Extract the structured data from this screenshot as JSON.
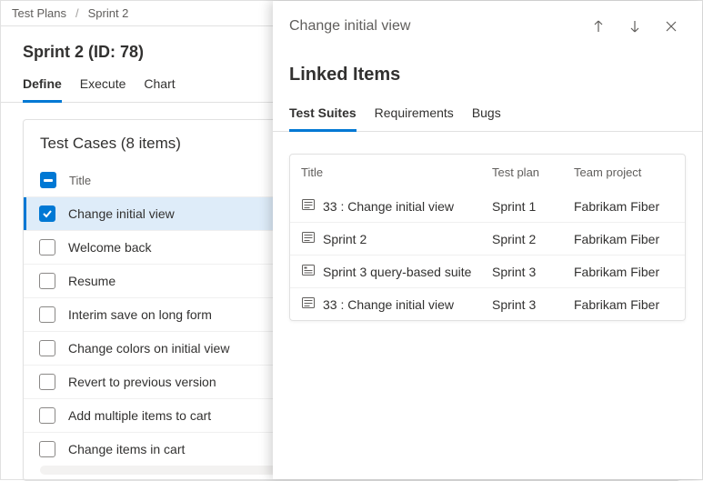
{
  "breadcrumb": {
    "root": "Test Plans",
    "current": "Sprint 2"
  },
  "page": {
    "title": "Sprint 2 (ID: 78)"
  },
  "main_tabs": [
    {
      "label": "Define",
      "active": true
    },
    {
      "label": "Execute",
      "active": false
    },
    {
      "label": "Chart",
      "active": false
    }
  ],
  "testcases": {
    "heading": "Test Cases (8 items)",
    "column_title": "Title",
    "items": [
      {
        "title": "Change initial view",
        "checked": true,
        "selected": true
      },
      {
        "title": "Welcome back",
        "checked": false
      },
      {
        "title": "Resume",
        "checked": false
      },
      {
        "title": "Interim save on long form",
        "checked": false
      },
      {
        "title": "Change colors on initial view",
        "checked": false
      },
      {
        "title": "Revert to previous version",
        "checked": false
      },
      {
        "title": "Add multiple items to cart",
        "checked": false
      },
      {
        "title": "Change items in cart",
        "checked": false
      }
    ]
  },
  "panel": {
    "title": "Change initial view",
    "section": "Linked Items",
    "tabs": [
      {
        "label": "Test Suites",
        "active": true
      },
      {
        "label": "Requirements",
        "active": false
      },
      {
        "label": "Bugs",
        "active": false
      }
    ],
    "columns": {
      "title": "Title",
      "plan": "Test plan",
      "team": "Team project"
    },
    "rows": [
      {
        "icon": "static",
        "title": "33 : Change initial view",
        "plan": "Sprint 1",
        "team": "Fabrikam Fiber"
      },
      {
        "icon": "static",
        "title": "Sprint 2",
        "plan": "Sprint 2",
        "team": "Fabrikam Fiber"
      },
      {
        "icon": "query",
        "title": "Sprint 3 query-based suite",
        "plan": "Sprint 3",
        "team": "Fabrikam Fiber"
      },
      {
        "icon": "static",
        "title": "33 : Change initial view",
        "plan": "Sprint 3",
        "team": "Fabrikam Fiber"
      }
    ]
  }
}
